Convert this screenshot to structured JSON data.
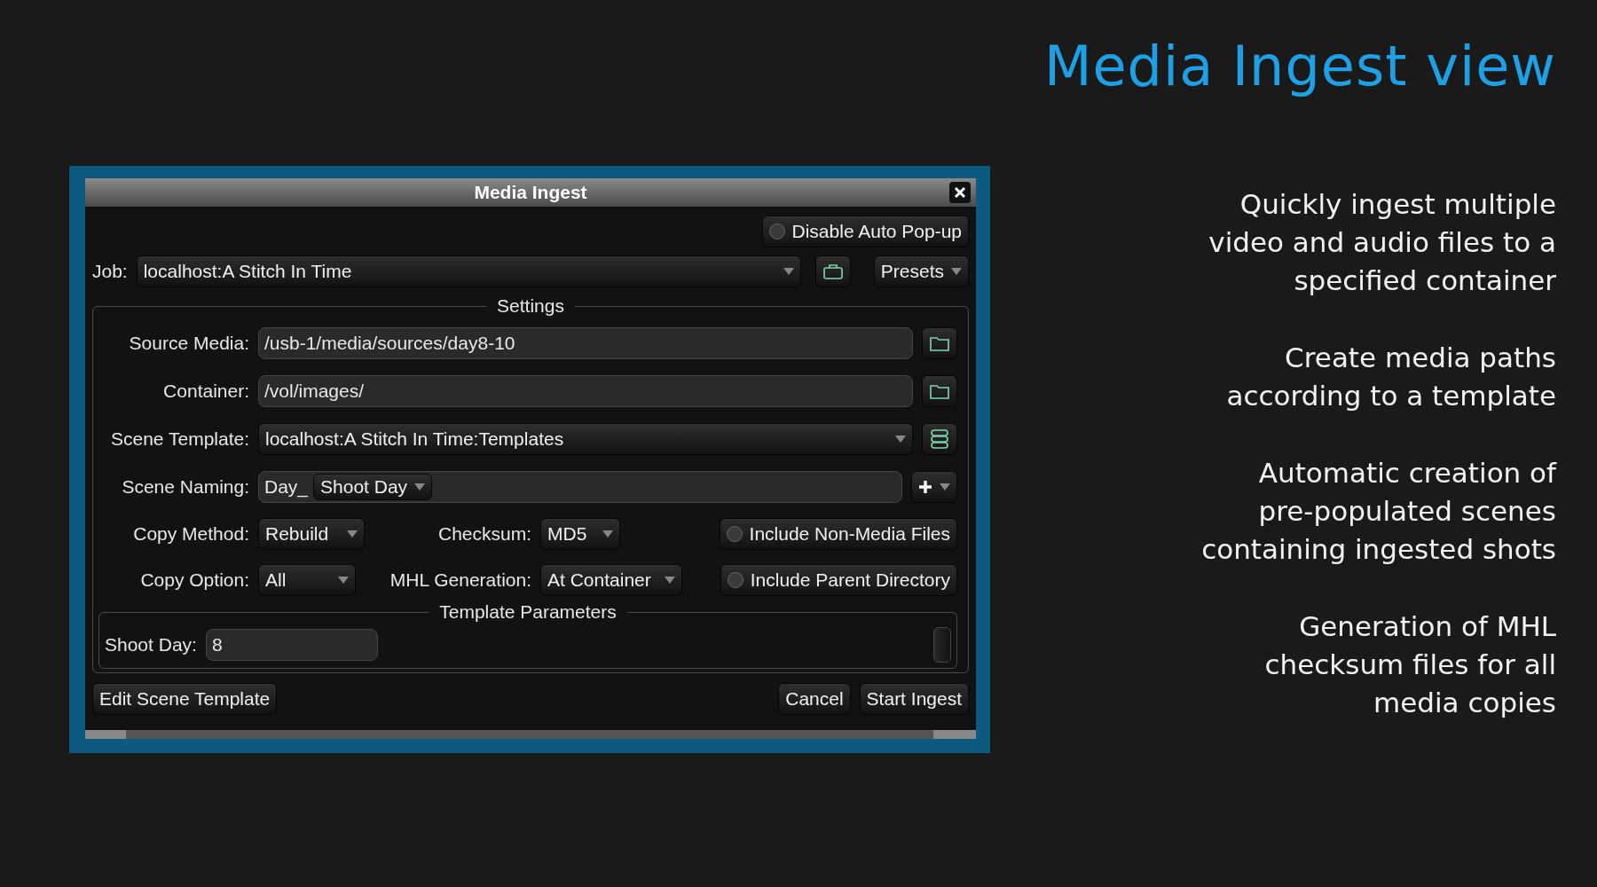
{
  "slide": {
    "title": "Media Ingest view",
    "features": [
      "Quickly ingest multiple\nvideo and audio files to a\nspecified container",
      "Create media paths\naccording to a template",
      "Automatic creation of\npre-populated scenes\ncontaining ingested shots",
      "Generation of MHL\nchecksum files for all\nmedia copies"
    ]
  },
  "dialog": {
    "title": "Media Ingest",
    "disable_auto_popup": {
      "label": "Disable Auto Pop-up",
      "checked": false
    },
    "job": {
      "label": "Job:",
      "value": "localhost:A Stitch In Time"
    },
    "presets_button": "Presets",
    "settings": {
      "title": "Settings",
      "source_media": {
        "label": "Source Media:",
        "value": "/usb-1/media/sources/day8-10"
      },
      "container": {
        "label": "Container:",
        "value": "/vol/images/"
      },
      "scene_template": {
        "label": "Scene Template:",
        "value": "localhost:A Stitch In Time:Templates"
      },
      "scene_naming": {
        "label": "Scene Naming:",
        "prefix": "Day_",
        "token": "Shoot Day"
      },
      "copy_method": {
        "label": "Copy Method:",
        "value": "Rebuild"
      },
      "checksum": {
        "label": "Checksum:",
        "value": "MD5"
      },
      "include_non_media": {
        "label": "Include Non-Media Files",
        "checked": false
      },
      "copy_option": {
        "label": "Copy Option:",
        "value": "All"
      },
      "mhl_generation": {
        "label": "MHL Generation:",
        "value": "At Container"
      },
      "include_parent_directory": {
        "label": "Include Parent Directory",
        "checked": false
      }
    },
    "template_parameters": {
      "title": "Template Parameters",
      "fields": [
        {
          "label": "Shoot Day:",
          "value": "8"
        }
      ]
    },
    "buttons": {
      "edit": "Edit Scene Template",
      "cancel": "Cancel",
      "start": "Start Ingest"
    }
  }
}
